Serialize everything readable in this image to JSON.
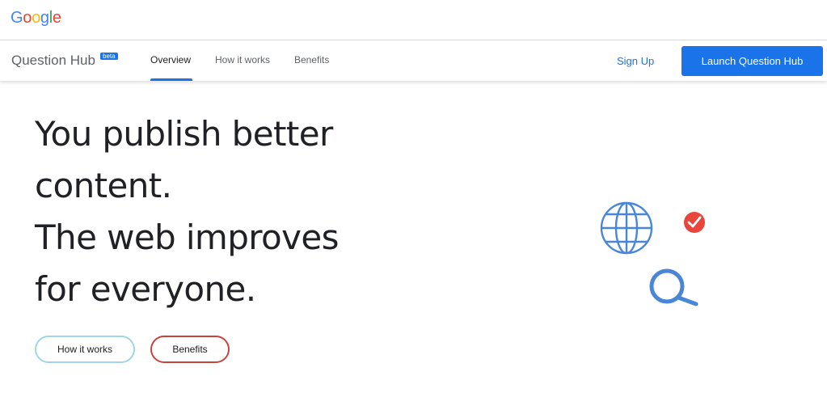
{
  "brand": {
    "logo_letters": [
      {
        "char": "G",
        "color": "#4285F4"
      },
      {
        "char": "o",
        "color": "#EA4335"
      },
      {
        "char": "o",
        "color": "#FBBC05"
      },
      {
        "char": "g",
        "color": "#4285F4"
      },
      {
        "char": "l",
        "color": "#34A853"
      },
      {
        "char": "e",
        "color": "#EA4335"
      }
    ]
  },
  "nav": {
    "product_name": "Question Hub",
    "badge": "beta",
    "links": [
      {
        "label": "Overview",
        "active": true
      },
      {
        "label": "How it works",
        "active": false
      },
      {
        "label": "Benefits",
        "active": false
      }
    ],
    "signup_label": "Sign Up",
    "launch_label": "Launch Question Hub"
  },
  "hero": {
    "headline_lines": [
      "You publish better",
      "content.",
      "The web improves",
      "for everyone."
    ],
    "buttons": {
      "how_it_works": "How it works",
      "benefits": "Benefits"
    }
  },
  "illustration": {
    "icons": [
      "globe-icon",
      "check-circle-icon",
      "magnifier-icon"
    ]
  },
  "colors": {
    "accent": "#1a73e8",
    "illustration_blue": "#4a86d8",
    "check_red": "#e8453c",
    "how_border": "#9fd4ea",
    "benefits_border": "#c5453b"
  }
}
